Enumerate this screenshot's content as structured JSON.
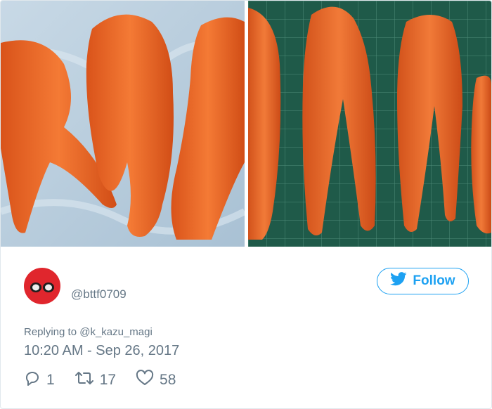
{
  "tweet": {
    "handle": "@bttf0709",
    "follow_label": "Follow",
    "replying_to": "Replying to @k_kazu_magi",
    "timestamp": "10:20 AM - Sep 26, 2017",
    "stats": {
      "replies": "1",
      "retweets": "17",
      "likes": "58"
    }
  },
  "colors": {
    "twitter_blue": "#1da1f2",
    "secondary_text": "#657786",
    "avatar_red": "#e0262d",
    "carrot_orange": "#f0722e"
  },
  "icons": [
    "twitter-bird-icon",
    "reply-icon",
    "retweet-icon",
    "heart-icon"
  ]
}
